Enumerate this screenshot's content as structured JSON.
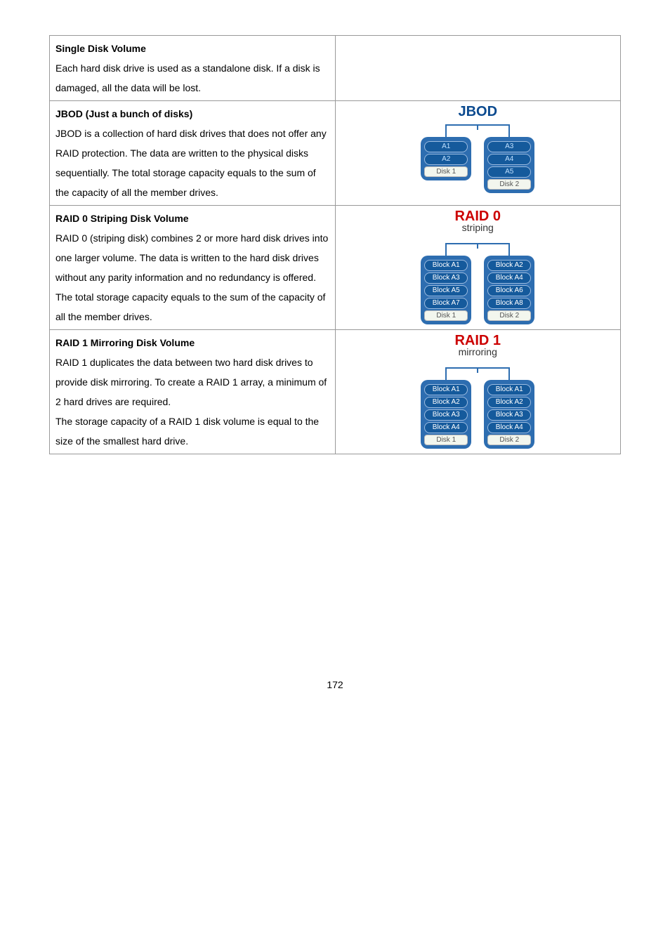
{
  "rows": [
    {
      "title": "Single Disk Volume",
      "body": "Each hard disk drive is used as a standalone disk.  If a disk is damaged, all the data will be lost."
    },
    {
      "title": "JBOD (Just a bunch of disks)",
      "body": "JBOD is a collection of hard disk drives that does not offer any RAID protection. The data are written to the physical disks sequentially.  The total storage capacity equals to the sum of the capacity of all the member drives.",
      "diagram": {
        "title": "JBOD",
        "title_color": "blue",
        "subtitle": "",
        "disks": [
          {
            "blocks": [
              "A1",
              "A2"
            ],
            "label": "Disk 1"
          },
          {
            "blocks": [
              "A3",
              "A4",
              "A5"
            ],
            "label": "Disk 2"
          }
        ]
      }
    },
    {
      "title": "RAID 0 Striping Disk Volume",
      "body": "RAID 0 (striping disk) combines 2 or more hard disk drives into one larger volume. The data is written to the hard disk drives without any parity information and no redundancy is offered.",
      "body2": "The total storage capacity equals to the sum of the capacity of all the member drives.",
      "diagram": {
        "title": "RAID 0",
        "title_color": "red",
        "subtitle": "striping",
        "disks": [
          {
            "blocks": [
              "Block A1",
              "Block A3",
              "Block A5",
              "Block A7"
            ],
            "label": "Disk 1"
          },
          {
            "blocks": [
              "Block A2",
              "Block A4",
              "Block A6",
              "Block A8"
            ],
            "label": "Disk 2"
          }
        ]
      }
    },
    {
      "title": "RAID 1 Mirroring Disk Volume",
      "body": "RAID 1 duplicates the data between two hard disk drives to provide disk mirroring. To create a RAID 1 array, a minimum of 2 hard drives are required.",
      "body2": "The storage capacity of a RAID 1 disk volume is equal to the size of the smallest hard drive.",
      "diagram": {
        "title": "RAID 1",
        "title_color": "red",
        "subtitle": "mirroring",
        "disks": [
          {
            "blocks": [
              "Block A1",
              "Block A2",
              "Block A3",
              "Block A4"
            ],
            "label": "Disk 1"
          },
          {
            "blocks": [
              "Block A1",
              "Block A2",
              "Block A3",
              "Block A4"
            ],
            "label": "Disk 2"
          }
        ]
      }
    }
  ],
  "page_number": "172"
}
